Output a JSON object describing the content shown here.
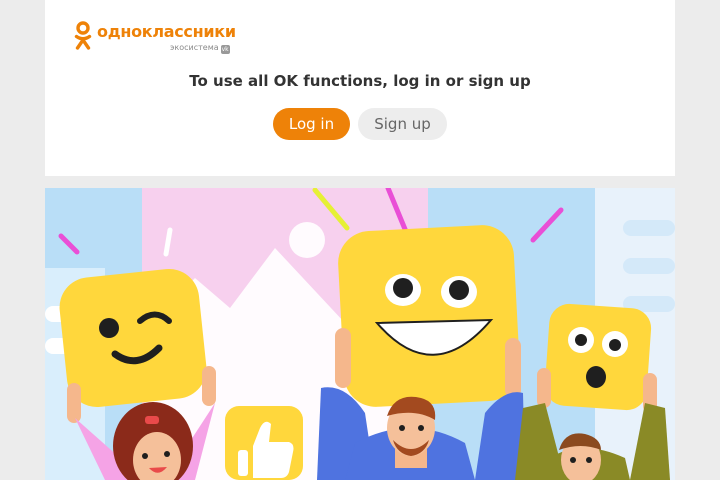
{
  "brand": {
    "name": "одноклассники",
    "tagline": "экосистема",
    "vk_badge": "vk",
    "accent_color": "#ee8208"
  },
  "auth": {
    "prompt": "To use all OK functions, log in or sign up",
    "login_label": "Log in",
    "signup_label": "Sign up"
  },
  "banner": {
    "description_icons": [
      "winking-face-sign",
      "laughing-face-sign",
      "surprised-face-sign",
      "thumbs-up-sign"
    ]
  }
}
